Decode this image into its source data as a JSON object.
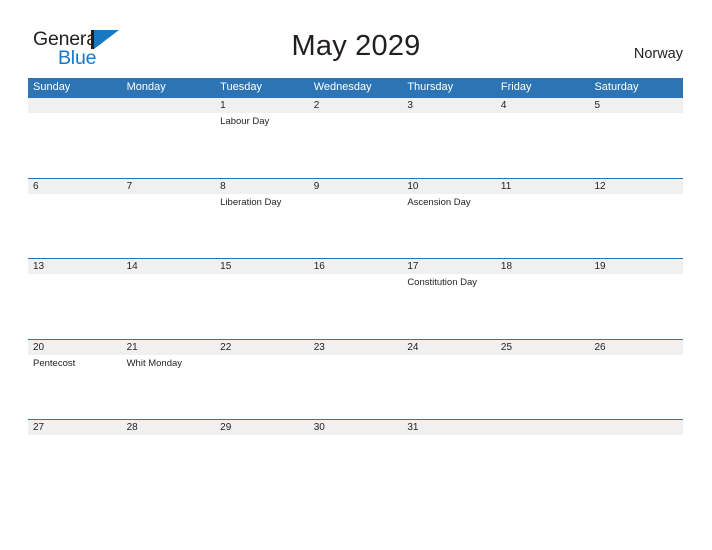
{
  "brand": {
    "name_part1": "General",
    "name_part2": "Blue",
    "accent_color": "#1878c4",
    "flag_icon": "general-blue-flag-icon"
  },
  "header": {
    "title": "May 2029",
    "country": "Norway"
  },
  "theme": {
    "header_blue": "#2d74b5",
    "date_band_gray": "#f0f0f0",
    "text_color": "#231f20"
  },
  "calendar": {
    "month": "May",
    "year": "2029",
    "weekdays": [
      "Sunday",
      "Monday",
      "Tuesday",
      "Wednesday",
      "Thursday",
      "Friday",
      "Saturday"
    ],
    "weeks": [
      [
        {
          "date": "",
          "event": ""
        },
        {
          "date": "",
          "event": ""
        },
        {
          "date": "1",
          "event": "Labour Day"
        },
        {
          "date": "2",
          "event": ""
        },
        {
          "date": "3",
          "event": ""
        },
        {
          "date": "4",
          "event": ""
        },
        {
          "date": "5",
          "event": ""
        }
      ],
      [
        {
          "date": "6",
          "event": ""
        },
        {
          "date": "7",
          "event": ""
        },
        {
          "date": "8",
          "event": "Liberation Day"
        },
        {
          "date": "9",
          "event": ""
        },
        {
          "date": "10",
          "event": "Ascension Day"
        },
        {
          "date": "11",
          "event": ""
        },
        {
          "date": "12",
          "event": ""
        }
      ],
      [
        {
          "date": "13",
          "event": ""
        },
        {
          "date": "14",
          "event": ""
        },
        {
          "date": "15",
          "event": ""
        },
        {
          "date": "16",
          "event": ""
        },
        {
          "date": "17",
          "event": "Constitution Day"
        },
        {
          "date": "18",
          "event": ""
        },
        {
          "date": "19",
          "event": ""
        }
      ],
      [
        {
          "date": "20",
          "event": "Pentecost"
        },
        {
          "date": "21",
          "event": "Whit Monday"
        },
        {
          "date": "22",
          "event": ""
        },
        {
          "date": "23",
          "event": ""
        },
        {
          "date": "24",
          "event": ""
        },
        {
          "date": "25",
          "event": ""
        },
        {
          "date": "26",
          "event": ""
        }
      ],
      [
        {
          "date": "27",
          "event": ""
        },
        {
          "date": "28",
          "event": ""
        },
        {
          "date": "29",
          "event": ""
        },
        {
          "date": "30",
          "event": ""
        },
        {
          "date": "31",
          "event": ""
        },
        {
          "date": "",
          "event": ""
        },
        {
          "date": "",
          "event": ""
        }
      ]
    ]
  }
}
